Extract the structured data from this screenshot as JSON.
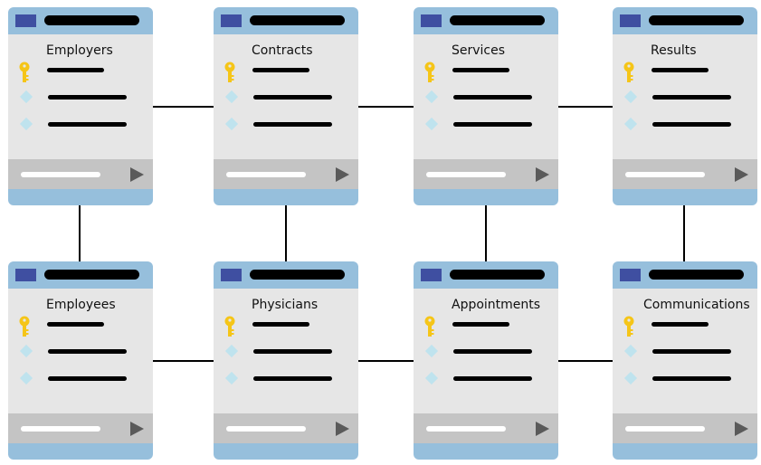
{
  "diagram": {
    "type": "entity-relationship",
    "entities": [
      {
        "name": "Employers",
        "row": 1,
        "col": 1
      },
      {
        "name": "Contracts",
        "row": 1,
        "col": 2
      },
      {
        "name": "Services",
        "row": 1,
        "col": 3
      },
      {
        "name": "Results",
        "row": 1,
        "col": 4
      },
      {
        "name": "Employees",
        "row": 2,
        "col": 1
      },
      {
        "name": "Physicians",
        "row": 2,
        "col": 2
      },
      {
        "name": "Appointments",
        "row": 2,
        "col": 3
      },
      {
        "name": "Communications",
        "row": 2,
        "col": 4
      }
    ],
    "relationships": [
      {
        "from": "Employers",
        "to": "Contracts"
      },
      {
        "from": "Contracts",
        "to": "Services"
      },
      {
        "from": "Services",
        "to": "Results"
      },
      {
        "from": "Employees",
        "to": "Physicians"
      },
      {
        "from": "Physicians",
        "to": "Appointments"
      },
      {
        "from": "Appointments",
        "to": "Communications"
      },
      {
        "from": "Employers",
        "to": "Employees"
      },
      {
        "from": "Contracts",
        "to": "Physicians"
      },
      {
        "from": "Services",
        "to": "Appointments"
      },
      {
        "from": "Results",
        "to": "Communications"
      }
    ],
    "icons": {
      "primary_key": "key-icon",
      "field": "diamond-icon",
      "footer_action": "play-arrow-icon"
    },
    "colors": {
      "card_frame": "#96bfdc",
      "title_square": "#3f4fa1",
      "card_body": "#e6e6e6",
      "footer": "#c4c4c4",
      "key": "#f5c518",
      "field_diamond": "#bfe3ee"
    }
  }
}
